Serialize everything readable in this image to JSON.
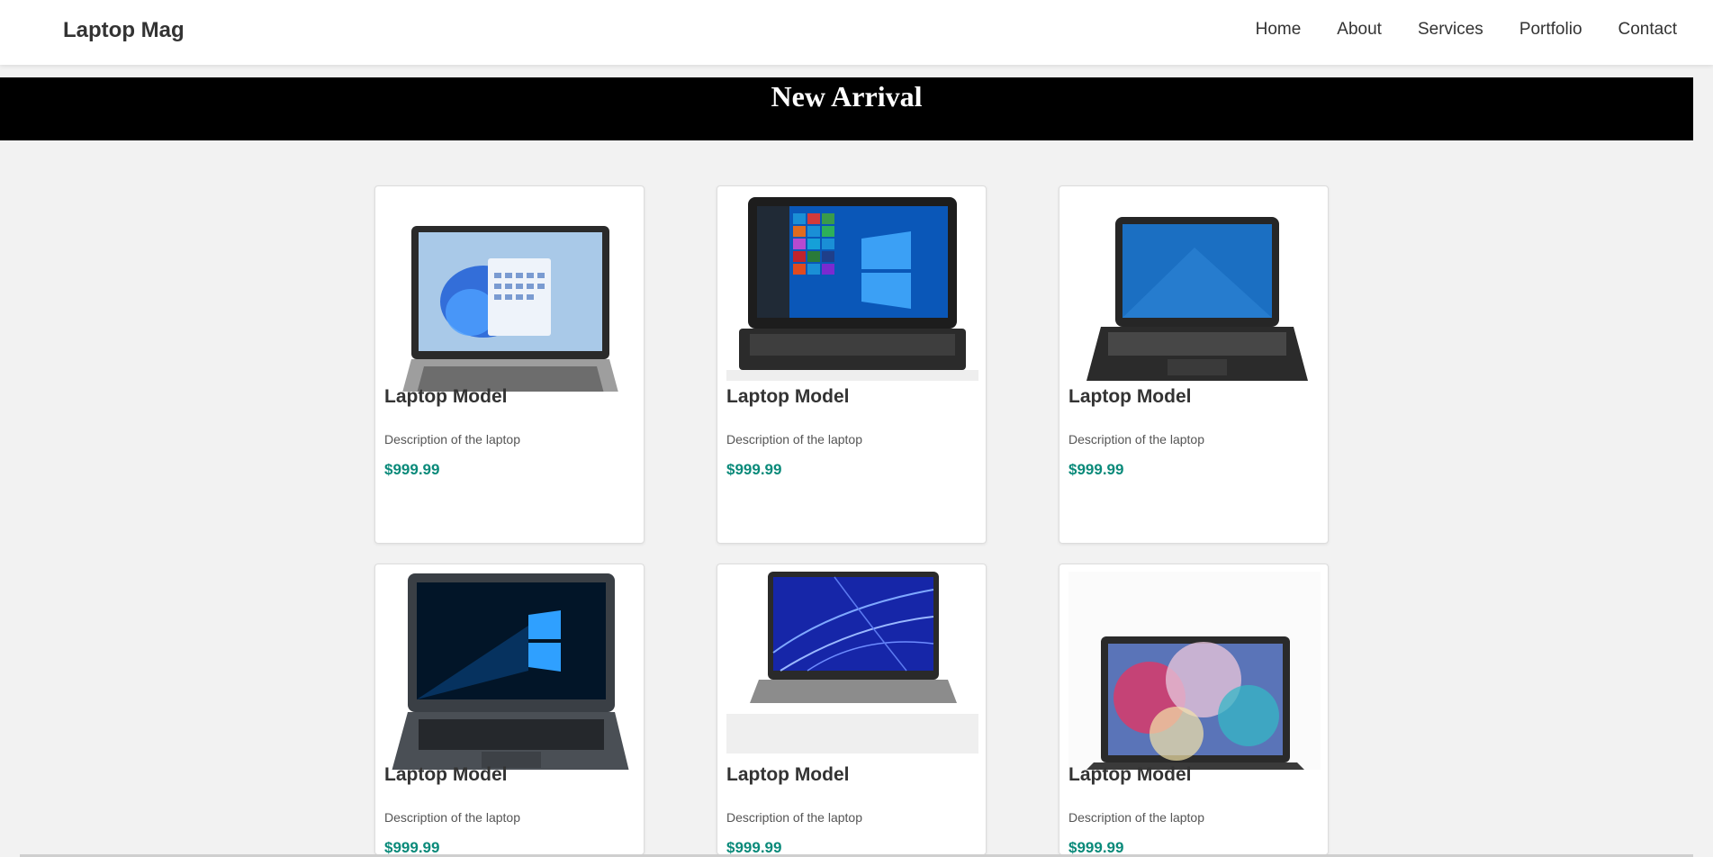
{
  "brand": "Laptop Mag",
  "nav": [
    "Home",
    "About",
    "Services",
    "Portfolio",
    "Contact"
  ],
  "banner": {
    "title": "New Arrival"
  },
  "products": [
    {
      "title": "Laptop Model",
      "description": "Description of the laptop",
      "price": "$999.99",
      "image": "silver-laptop-windows-11"
    },
    {
      "title": "Laptop Model",
      "description": "Description of the laptop",
      "price": "$999.99",
      "image": "black-laptop-windows-10-start"
    },
    {
      "title": "Laptop Model",
      "description": "Description of the laptop",
      "price": "$999.99",
      "image": "black-laptop-blue-screen"
    },
    {
      "title": "Laptop Model",
      "description": "Description of the laptop",
      "price": "$999.99",
      "image": "black-laptop-windows-logo"
    },
    {
      "title": "Laptop Model",
      "description": "Description of the laptop",
      "price": "$999.99",
      "image": "silver-laptop-blue-mesh"
    },
    {
      "title": "Laptop Model",
      "description": "Description of the laptop",
      "price": "$999.99",
      "image": "black-laptop-colorful-clouds"
    }
  ],
  "colors": {
    "price": "#0a8a7a",
    "banner_bg": "#000000",
    "page_bg": "#f2f2f2"
  }
}
